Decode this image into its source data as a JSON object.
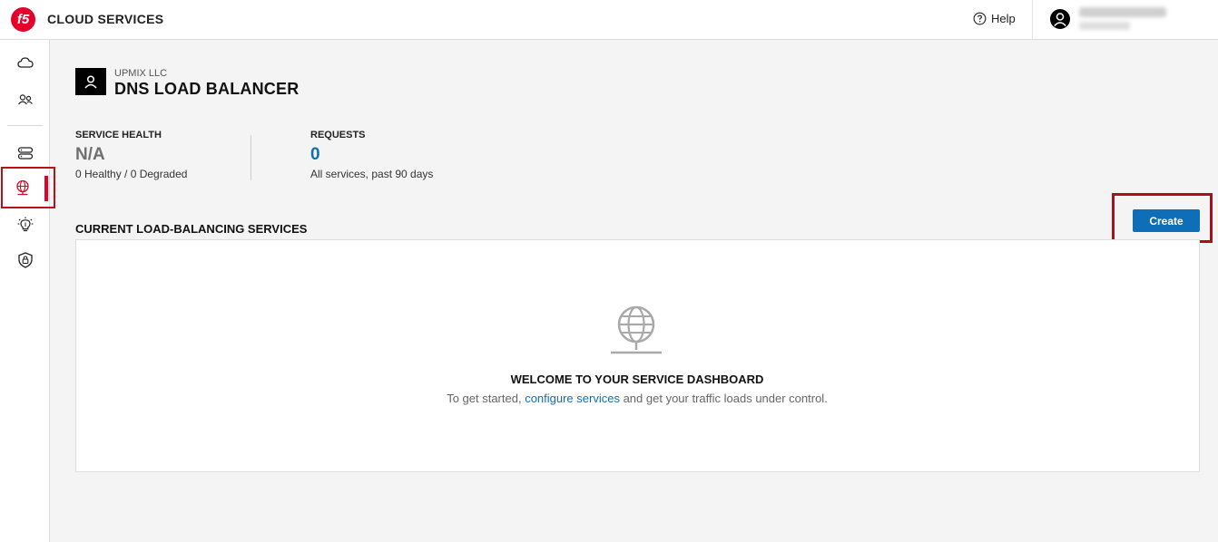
{
  "header": {
    "logo_text": "f5",
    "brand": "CLOUD SERVICES",
    "help_label": "Help"
  },
  "sidebar": {
    "items": [
      {
        "icon": "cloud-icon"
      },
      {
        "icon": "users-icon"
      },
      {
        "icon": "server-icon"
      },
      {
        "icon": "globe-icon",
        "active": true
      },
      {
        "icon": "lightbulb-icon"
      },
      {
        "icon": "shield-lock-icon"
      }
    ]
  },
  "page": {
    "org": "UPMIX LLC",
    "title": "DNS LOAD BALANCER"
  },
  "stats": {
    "health_label": "SERVICE HEALTH",
    "health_value": "N/A",
    "health_sub": "0 Healthy / 0 Degraded",
    "requests_label": "REQUESTS",
    "requests_value": "0",
    "requests_sub": "All services, past 90 days"
  },
  "services": {
    "title": "CURRENT LOAD-BALANCING SERVICES",
    "create_label": "Create",
    "empty_title": "WELCOME TO YOUR SERVICE DASHBOARD",
    "empty_text_before": "To get started, ",
    "empty_link": "configure services",
    "empty_text_after": " and get your traffic loads under control."
  },
  "colors": {
    "brand_red": "#e4002b",
    "accent_blue": "#0e6fb8",
    "highlight_red": "#a8101a"
  }
}
